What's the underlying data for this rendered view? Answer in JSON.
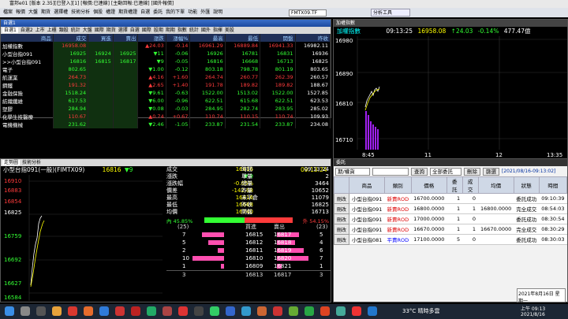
{
  "title": "富邦e01 [版本 2.35][已登入][1] [報價:已連線] [主動回報:已連線] [國外報價]",
  "menu": [
    "檔案",
    "報價",
    "大盤",
    "期貨",
    "選擇權",
    "技術分析",
    "個股",
    "權證",
    "期貨權證",
    "自選",
    "委託",
    "我的下單",
    "功能",
    "外匯",
    "說明"
  ],
  "product_box": "FMTX09.TF",
  "toolbar_right": "分析工具",
  "quote": {
    "window_title": "自選1",
    "tabs": [
      "自選1",
      "自選2",
      "上市",
      "上櫃",
      "類股",
      "統計",
      "大盤",
      "國際",
      "期貨",
      "選擇",
      "自選",
      "國際",
      "股期",
      "期期",
      "指數",
      "統計",
      "國外",
      "指揮",
      "美股"
    ],
    "headers": [
      "商品",
      "成交",
      "買進",
      "賣出",
      "漲跌",
      "漲幅%",
      "最高",
      "最低",
      "開盤",
      "昨收"
    ],
    "rows": [
      {
        "n": "加權指數",
        "c": "16958.08",
        "b": "",
        "s": "",
        "ch": "▲24.03",
        "p": "-0.14",
        "h": "16961.29",
        "l": "16889.84",
        "o": "16941.33",
        "y": "16982.11",
        "d": "up"
      },
      {
        "n": "小型台指091",
        "c": "16925",
        "b": "16924",
        "s": "16925",
        "ch": "▼11",
        "p": "-0.06",
        "h": "16926",
        "l": "16781",
        "o": "16831",
        "y": "16936",
        "d": "dn"
      },
      {
        "n": ">>小型台指091",
        "c": "16816",
        "b": "16815",
        "s": "16817",
        "ch": "▼9",
        "p": "-0.05",
        "h": "16816",
        "l": "16668",
        "o": "16713",
        "y": "16825",
        "d": "dn"
      },
      {
        "n": "電子",
        "c": "802.65",
        "b": "",
        "s": "",
        "ch": "▼1.00",
        "p": "-0.12",
        "h": "803.18",
        "l": "798.78",
        "o": "801.19",
        "y": "803.65",
        "d": "dn"
      },
      {
        "n": "航運業",
        "c": "264.73",
        "b": "",
        "s": "",
        "ch": "▲4.16",
        "p": "+1.60",
        "h": "264.74",
        "l": "260.77",
        "o": "262.39",
        "y": "260.57",
        "d": "up"
      },
      {
        "n": "鋼鐵",
        "c": "191.32",
        "b": "",
        "s": "",
        "ch": "▲2.65",
        "p": "+1.40",
        "h": "191.78",
        "l": "189.82",
        "o": "189.82",
        "y": "188.67",
        "d": "up"
      },
      {
        "n": "金融保險",
        "c": "1518.24",
        "b": "",
        "s": "",
        "ch": "▼9.61",
        "p": "-0.63",
        "h": "1522.00",
        "l": "1513.02",
        "o": "1522.00",
        "y": "1527.85",
        "d": "dn"
      },
      {
        "n": "紡織纖維",
        "c": "617.53",
        "b": "",
        "s": "",
        "ch": "▼6.00",
        "p": "-0.96",
        "h": "622.51",
        "l": "615.68",
        "o": "622.51",
        "y": "623.53",
        "d": "dn"
      },
      {
        "n": "塑膠",
        "c": "284.94",
        "b": "",
        "s": "",
        "ch": "▼0.08",
        "p": "-0.03",
        "h": "284.95",
        "l": "282.74",
        "o": "283.95",
        "y": "285.02",
        "d": "dn"
      },
      {
        "n": "化學生技醫療",
        "c": "110.67",
        "b": "",
        "s": "",
        "ch": "▲0.74",
        "p": "+0.67",
        "h": "110.74",
        "l": "110.15",
        "o": "110.74",
        "y": "109.93",
        "d": "up"
      },
      {
        "n": "電機機械",
        "c": "231.62",
        "b": "",
        "s": "",
        "ch": "▼2.46",
        "p": "-1.05",
        "h": "233.87",
        "l": "231.54",
        "o": "233.87",
        "y": "234.08",
        "d": "dn"
      }
    ]
  },
  "index_chart": {
    "tab": "加權指數",
    "name": "加權指數",
    "time": "09:13:25",
    "price": "16958.08",
    "change": "↑24.03",
    "pct": "-0.14%",
    "volume": "477.47億",
    "yticks": [
      "16980",
      "16890",
      "16810",
      "16710"
    ],
    "xticks": [
      "8:45",
      "11",
      "12",
      "13:35"
    ]
  },
  "tick": {
    "window_title": "走勢圖",
    "tab2": "技術分析",
    "name": "小型台指091(一般)(FIMTX09)",
    "price": "16816",
    "chg": "▼9",
    "time": "09:13:24",
    "yticks": [
      "16910",
      "16883",
      "16854",
      "16825",
      "16759",
      "16692",
      "16627",
      "16584"
    ],
    "info": [
      [
        "成交",
        "16816",
        "時間",
        "09:13:24"
      ],
      [
        "漲跌",
        "▼ 9",
        "單量",
        "2"
      ],
      [
        "漲跌幅",
        "-0.05%",
        "總量",
        "3464"
      ],
      [
        "價差",
        "-142.08",
        "昨量",
        "10652"
      ],
      [
        "最高",
        "16816",
        "未平倉",
        "11079"
      ],
      [
        "最低",
        "16668",
        "昨收",
        "16825"
      ],
      [
        "均價",
        "16740",
        "開盤",
        "16713"
      ]
    ],
    "bar_left": "內 45.85%",
    "bar_right": "外 54.15%",
    "bar_left_frac": 0.4585,
    "book_head": [
      "(25)",
      "買進",
      "賣出",
      "(23)"
    ],
    "book": [
      [
        "7",
        "16815",
        "16817",
        "5"
      ],
      [
        "5",
        "16812",
        "16818",
        "4"
      ],
      [
        "2",
        "16811",
        "16819",
        "6"
      ],
      [
        "10",
        "16810",
        "16820",
        "7"
      ],
      [
        "1",
        "16809",
        "16821",
        "1"
      ]
    ],
    "book_bid_frac": [
      0.7,
      0.5,
      0.2,
      1.0,
      0.1
    ],
    "book_ask_frac": [
      0.71,
      0.57,
      0.86,
      1.0,
      0.14
    ],
    "book_total": [
      "3",
      "16813",
      "16817",
      "3"
    ]
  },
  "orders": {
    "window_title": "委託",
    "account_label": "期/權貨",
    "query_btn": "查詢",
    "filter": "全部委託",
    "delete_btn": "刪除",
    "range_btn": "篩選",
    "range_text": "[2021/08/16-09:13:02]",
    "headers": [
      "",
      "商品",
      "類別",
      "價格",
      "委託",
      "成交",
      "均價",
      "狀態",
      "時間"
    ],
    "rows": [
      {
        "btn": "刪改",
        "p": "小型台指091",
        "t": "新賣ROD",
        "pr": "16700.0000",
        "q": "1",
        "f": "0",
        "a": "",
        "s": "委託成功",
        "tm": "09:10:39"
      },
      {
        "btn": "刪改",
        "p": "小型台指091",
        "t": "新賣ROD",
        "pr": "16800.0000",
        "q": "1",
        "f": "1",
        "a": "16800.0000",
        "s": "完全成交",
        "tm": "08:54:03"
      },
      {
        "btn": "刪改",
        "p": "小型台指091",
        "t": "新賣ROD",
        "pr": "17000.0000",
        "q": "1",
        "f": "0",
        "a": "",
        "s": "委託成功",
        "tm": "08:30:54"
      },
      {
        "btn": "刪改",
        "p": "小型台指091",
        "t": "新賣ROD",
        "pr": "16670.0000",
        "q": "1",
        "f": "1",
        "a": "16670.0000",
        "s": "完全成交",
        "tm": "08:30:29"
      },
      {
        "btn": "刪改",
        "p": "小型台指081",
        "t": "平賣ROD",
        "pr": "17100.0000",
        "q": "5",
        "f": "0",
        "a": "",
        "s": "委託成功",
        "tm": "08:30:03"
      }
    ]
  },
  "taskbar": {
    "weather": "33°C 晴時多雲",
    "time": "上午 09:13",
    "date": "2021/8/16",
    "popup": "2021年8月16日 星期一"
  }
}
